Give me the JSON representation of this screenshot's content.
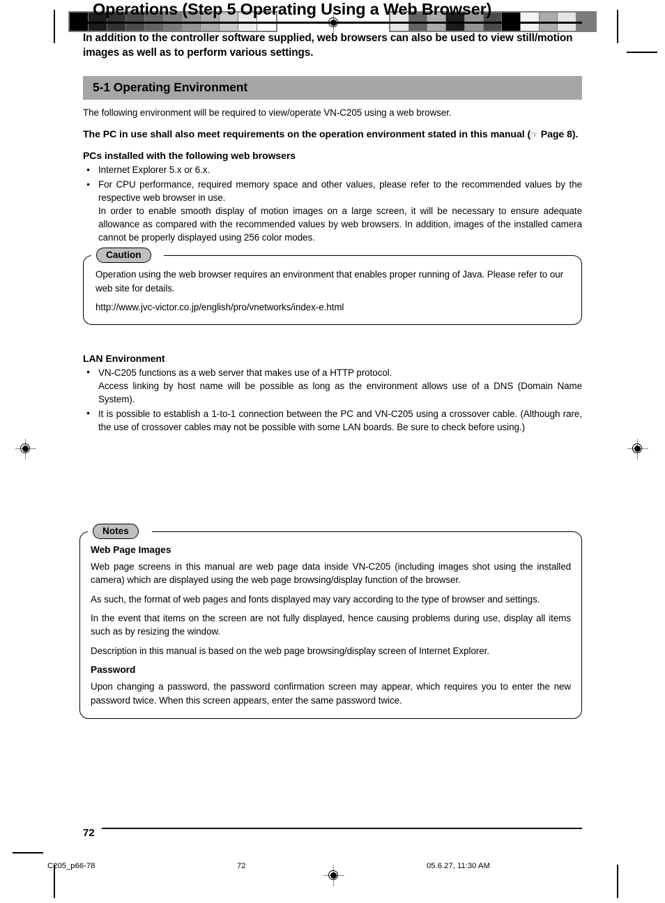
{
  "document": {
    "title": "Operations (Step 5 Operating Using a Web Browser)",
    "lead": "In addition to the controller software supplied, web browsers can also be used to view still/motion images as well as to perform various settings.",
    "page_number": "72"
  },
  "section": {
    "heading": "5-1 Operating Environment",
    "intro": "The following environment will be required to view/operate VN-C205 using a web browser.",
    "requirement_prefix": "The PC in use shall also meet requirements on the operation environment stated in this manual (",
    "requirement_icon": "☞",
    "requirement_suffix": " Page 8).",
    "browsers_heading": "PCs installed with the following web  browsers",
    "browsers": [
      "Internet Explorer 5.x or 6.x.",
      "For CPU performance, required memory space and other values, please refer to the recommended values by the respective web browser in use."
    ],
    "browsers_extra": "In order to enable smooth display of motion images on a large screen, it will be necessary to ensure adequate allowance as compared with the recommended values by web browsers. In addition, images of the installed camera cannot be properly displayed using 256 color modes."
  },
  "caution": {
    "label": "Caution",
    "line1": "Operation using the web browser requires an environment that enables proper running of Java. Please refer to our web site for details.",
    "line2": "http://www.jvc-victor.co.jp/english/pro/vnetworks/index-e.html"
  },
  "lan": {
    "heading": "LAN Environment",
    "item1_main": "VN-C205 functions as a web server that makes use of a HTTP protocol.",
    "item1_cont": "Access linking by host name will be possible as long as the environment allows use of a DNS (Domain Name System).",
    "item2": "It is possible to establish a 1-to-1 connection between the PC and VN-C205 using a crossover cable. (Although rare, the use of crossover cables may not be possible with some LAN boards. Be sure to check before using.)"
  },
  "notes": {
    "label": "Notes",
    "web_page_images_heading": "Web Page Images",
    "web_page_images_p1": "Web page screens in this manual are web page data inside VN-C205 (including images shot using the installed camera) which are displayed using the web page browsing/display function of the browser.",
    "web_page_images_p2": "As such, the format of web pages and fonts displayed may vary according to the type of browser and settings.",
    "web_page_images_p3": "In the event that items on the screen are not fully displayed, hence causing problems during use, display all items such as by resizing the window.",
    "web_page_images_p4": "Description in this manual is based on the web page browsing/display screen of Internet Explorer.",
    "password_heading": "Password",
    "password_p1": "Upon changing a password, the password confirmation screen may appear, which requires you to enter the new password twice. When this screen appears, enter the same password twice."
  },
  "footer": {
    "file_slug": "C205_p66-78",
    "page_slug": "72",
    "date_slug": "05.6.27, 11:30 AM"
  },
  "print_marks": {
    "wedge_left_colors": [
      "#000000",
      "#1c1c1c",
      "#323232",
      "#4b4b4b",
      "#636363",
      "#7b7b7b",
      "#949494",
      "#ababab",
      "#c8c8c8",
      "#ededed",
      "#ffffff"
    ],
    "wedge_right_colors": [
      "#e4e4e4",
      "#636363",
      "#ababab",
      "#1c1c1c",
      "#949494",
      "#4b4b4b",
      "#000000",
      "#f2f2f2",
      "#ababab",
      "#e4e4e4",
      "#7b7b7b"
    ]
  }
}
